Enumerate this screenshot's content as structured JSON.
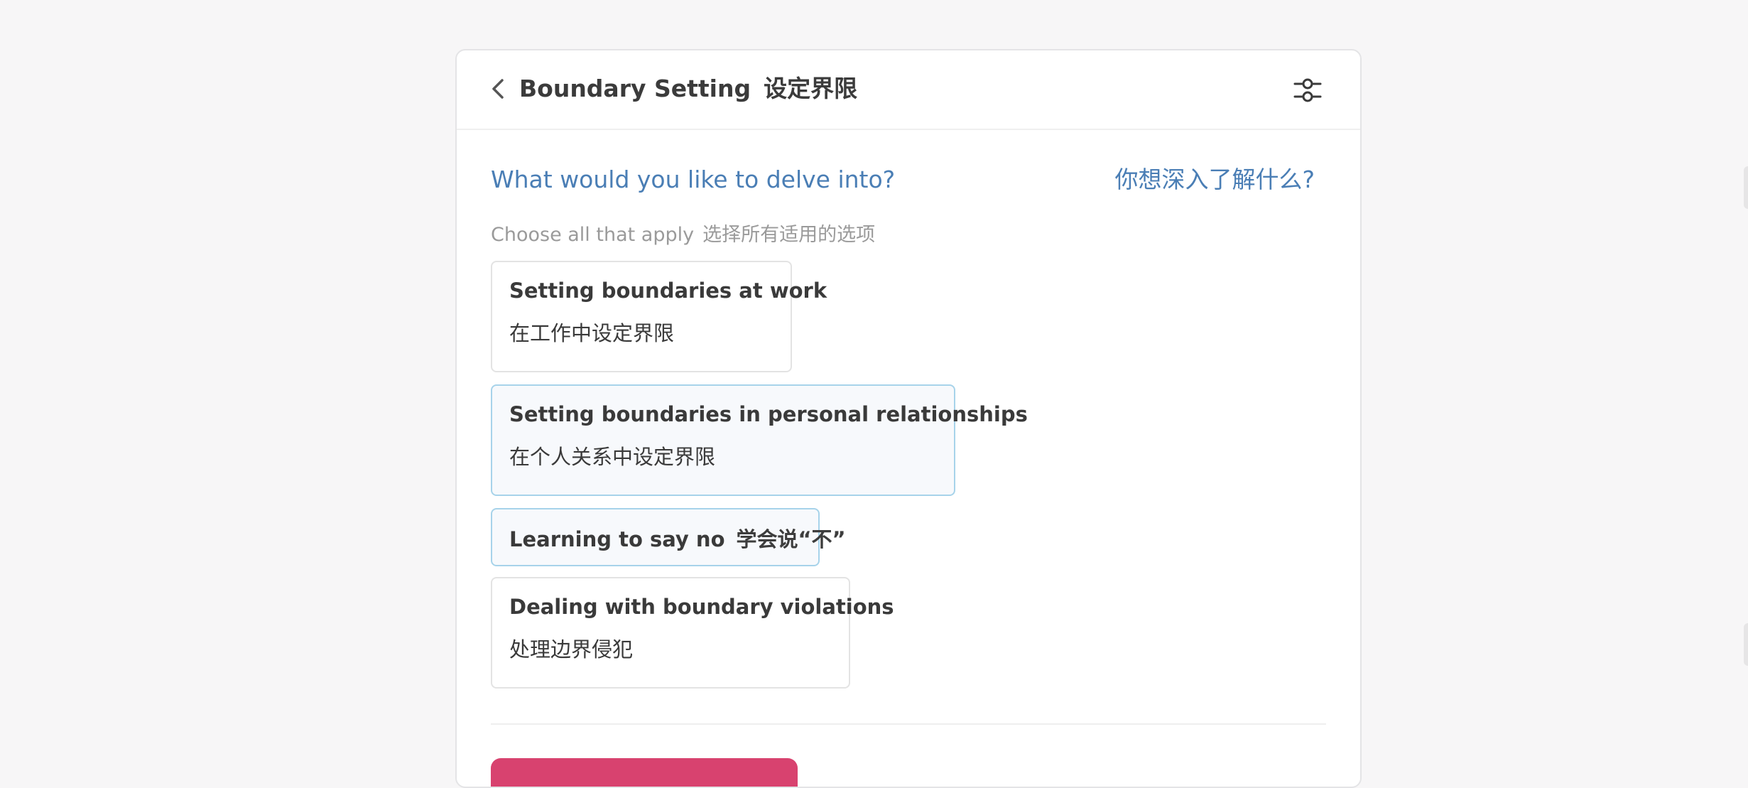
{
  "header": {
    "back_icon": "chevron-left-icon",
    "title_en": "Boundary Setting",
    "title_zh": "设定界限",
    "settings_icon": "sliders-icon"
  },
  "question": {
    "en": "What would you like to delve into?",
    "zh": "你想深入了解什么?"
  },
  "hint": {
    "en": "Choose all that apply",
    "zh": "选择所有适用的选项"
  },
  "options": [
    {
      "en": "Setting boundaries at work",
      "zh": "在工作中设定界限",
      "selected": false
    },
    {
      "en": "Setting boundaries in personal relationships",
      "zh": "在个人关系中设定界限",
      "selected": true
    },
    {
      "en": "Learning to say no",
      "zh": "学会说“不”",
      "selected": true
    },
    {
      "en": "Dealing with boundary violations",
      "zh": "处理边界侵犯",
      "selected": false
    }
  ],
  "colors": {
    "accent": "#4a7eb5",
    "selected_border": "#a7d3ea",
    "primary_button": "#d8426f"
  }
}
